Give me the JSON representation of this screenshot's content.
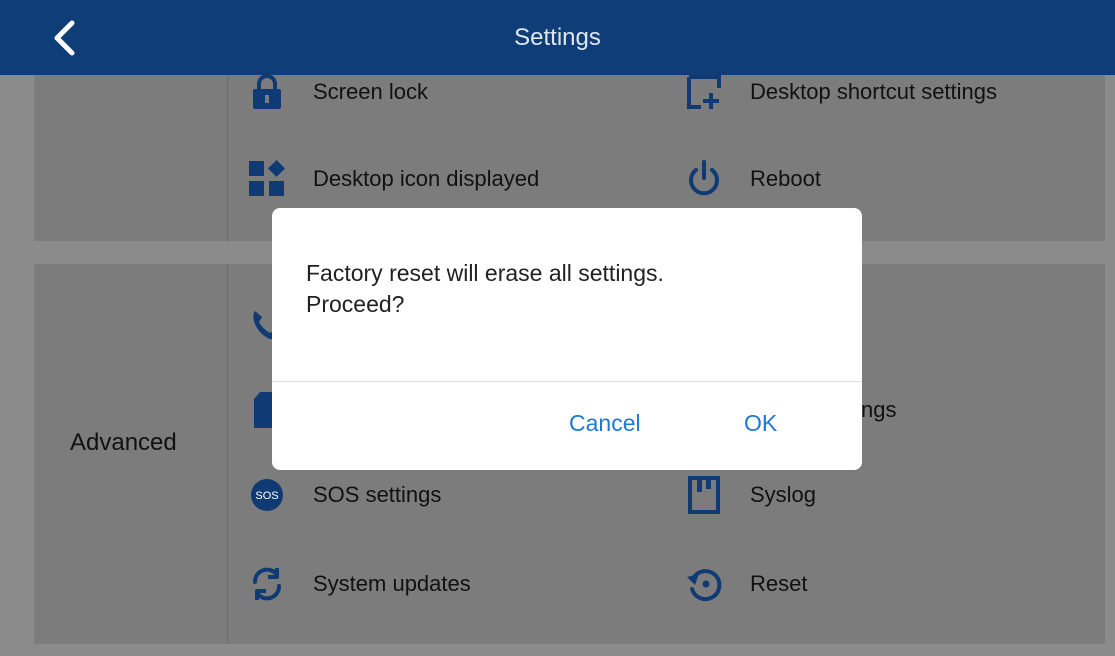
{
  "header": {
    "title": "Settings",
    "back_icon": "chevron-left-icon"
  },
  "sections": {
    "advanced_label": "Advanced"
  },
  "items": {
    "screen_lock": "Screen lock",
    "desktop_shortcut": "Desktop shortcut settings",
    "desktop_icon": "Desktop icon displayed",
    "reboot": "Reboot",
    "partial_right": "tings",
    "sos": "SOS settings",
    "syslog": "Syslog",
    "system_updates": "System updates",
    "reset": "Reset",
    "sos_badge": "SOS"
  },
  "dialog": {
    "message_line1": "Factory reset will erase all settings.",
    "message_line2": "Proceed?",
    "cancel_label": "Cancel",
    "ok_label": "OK"
  },
  "colors": {
    "header_bg": "#0f3d78",
    "icon_blue": "#103a73",
    "accent": "#1e78d6"
  }
}
